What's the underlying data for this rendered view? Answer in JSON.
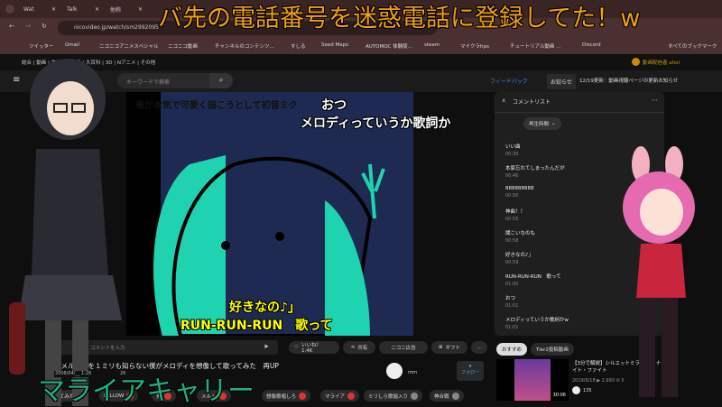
{
  "browser": {
    "tabs": [
      "Wat",
      "Talk",
      "他称",
      "ド",
      "ライ"
    ],
    "url": "nicovideo.jp/watch/sm2992095",
    "bookmarks": [
      "ツイッター",
      "Gmail",
      "ニコニコアニメスペシャル",
      "ニコニコ動画",
      "チャンネルのコンテンツ...",
      "すしる",
      "Seed Maps",
      "AUTOMOC 体験版...",
      "steam",
      "マイクラtips",
      "チュートリアル動画 ...",
      "Discord",
      "すべてのブックマーク"
    ]
  },
  "nico": {
    "nav": "総合 | 動画 | 生放送 | 静画 | 大百科 | 3D | Nアニメ | その他",
    "search_placeholder": "キーワードで検索",
    "feedback": "フィードバック",
    "notice_label": "お知らせ",
    "notice_text": "12/19更新：動画視聴ページの更新お知らせ",
    "user": "動画配信者 ahoi"
  },
  "overlay": {
    "title": "バ先の電話番号を迷惑電話に登録してた！w",
    "name": "マライアキャリー"
  },
  "video": {
    "header": "俺が本気で可愛く描こうとして初音ミク",
    "subs_top": [
      "おつ",
      "メロディっていうか歌詞か"
    ],
    "subs_bottom": [
      "好きなの♪」",
      "RUN-RUN-RUN　歌って"
    ]
  },
  "comments": {
    "title": "コメントリスト",
    "sort": "再生時間",
    "items": [
      {
        "text": "いい曲",
        "time": "00:39"
      },
      {
        "text": "本家忘れてしまったんだが",
        "time": "00:46"
      },
      {
        "text": "888888888",
        "time": "00:50"
      },
      {
        "text": "神曲！！",
        "time": "00:55"
      },
      {
        "text": "聞こいなのも",
        "time": "00:58"
      },
      {
        "text": "好きなの♪」",
        "time": "00:59"
      },
      {
        "text": "RUN-RUN-RUN　歌って",
        "time": "01:00"
      },
      {
        "text": "おつ",
        "time": "01:01"
      },
      {
        "text": "メロディっていうか歌詞かw",
        "time": "01:01"
      }
    ]
  },
  "actions": {
    "comment_placeholder": "コメントを入力",
    "like": "いいね！ 1.4K",
    "share": "共有",
    "nicoad": "ニコニ広告",
    "gift": "ギフト",
    "more": "…"
  },
  "meta": {
    "title": "「メルト」を１ミリも知らない僕がメロディを想像して歌ってみた　再UP",
    "date": "2008/04/__ 1:26",
    "comments": "26",
    "uploader": "ｍｍ",
    "follow": "フォロー"
  },
  "tags": [
    "歌ってみた",
    "FELLOW",
    "男",
    "メルト",
    "想像歌唱しろ",
    "マライア",
    "ミリしら歌謡入り",
    "神合戦"
  ],
  "related": {
    "tabs": [
      "おすすめ",
      "Tier2投稿動画"
    ],
    "title": "【3分で解説】シルエットミラージュ ナイト・ファイト",
    "stats": "2019/9/18 ▶ 2,993 ✉ 5",
    "duration": "30:06",
    "likes": "135"
  }
}
